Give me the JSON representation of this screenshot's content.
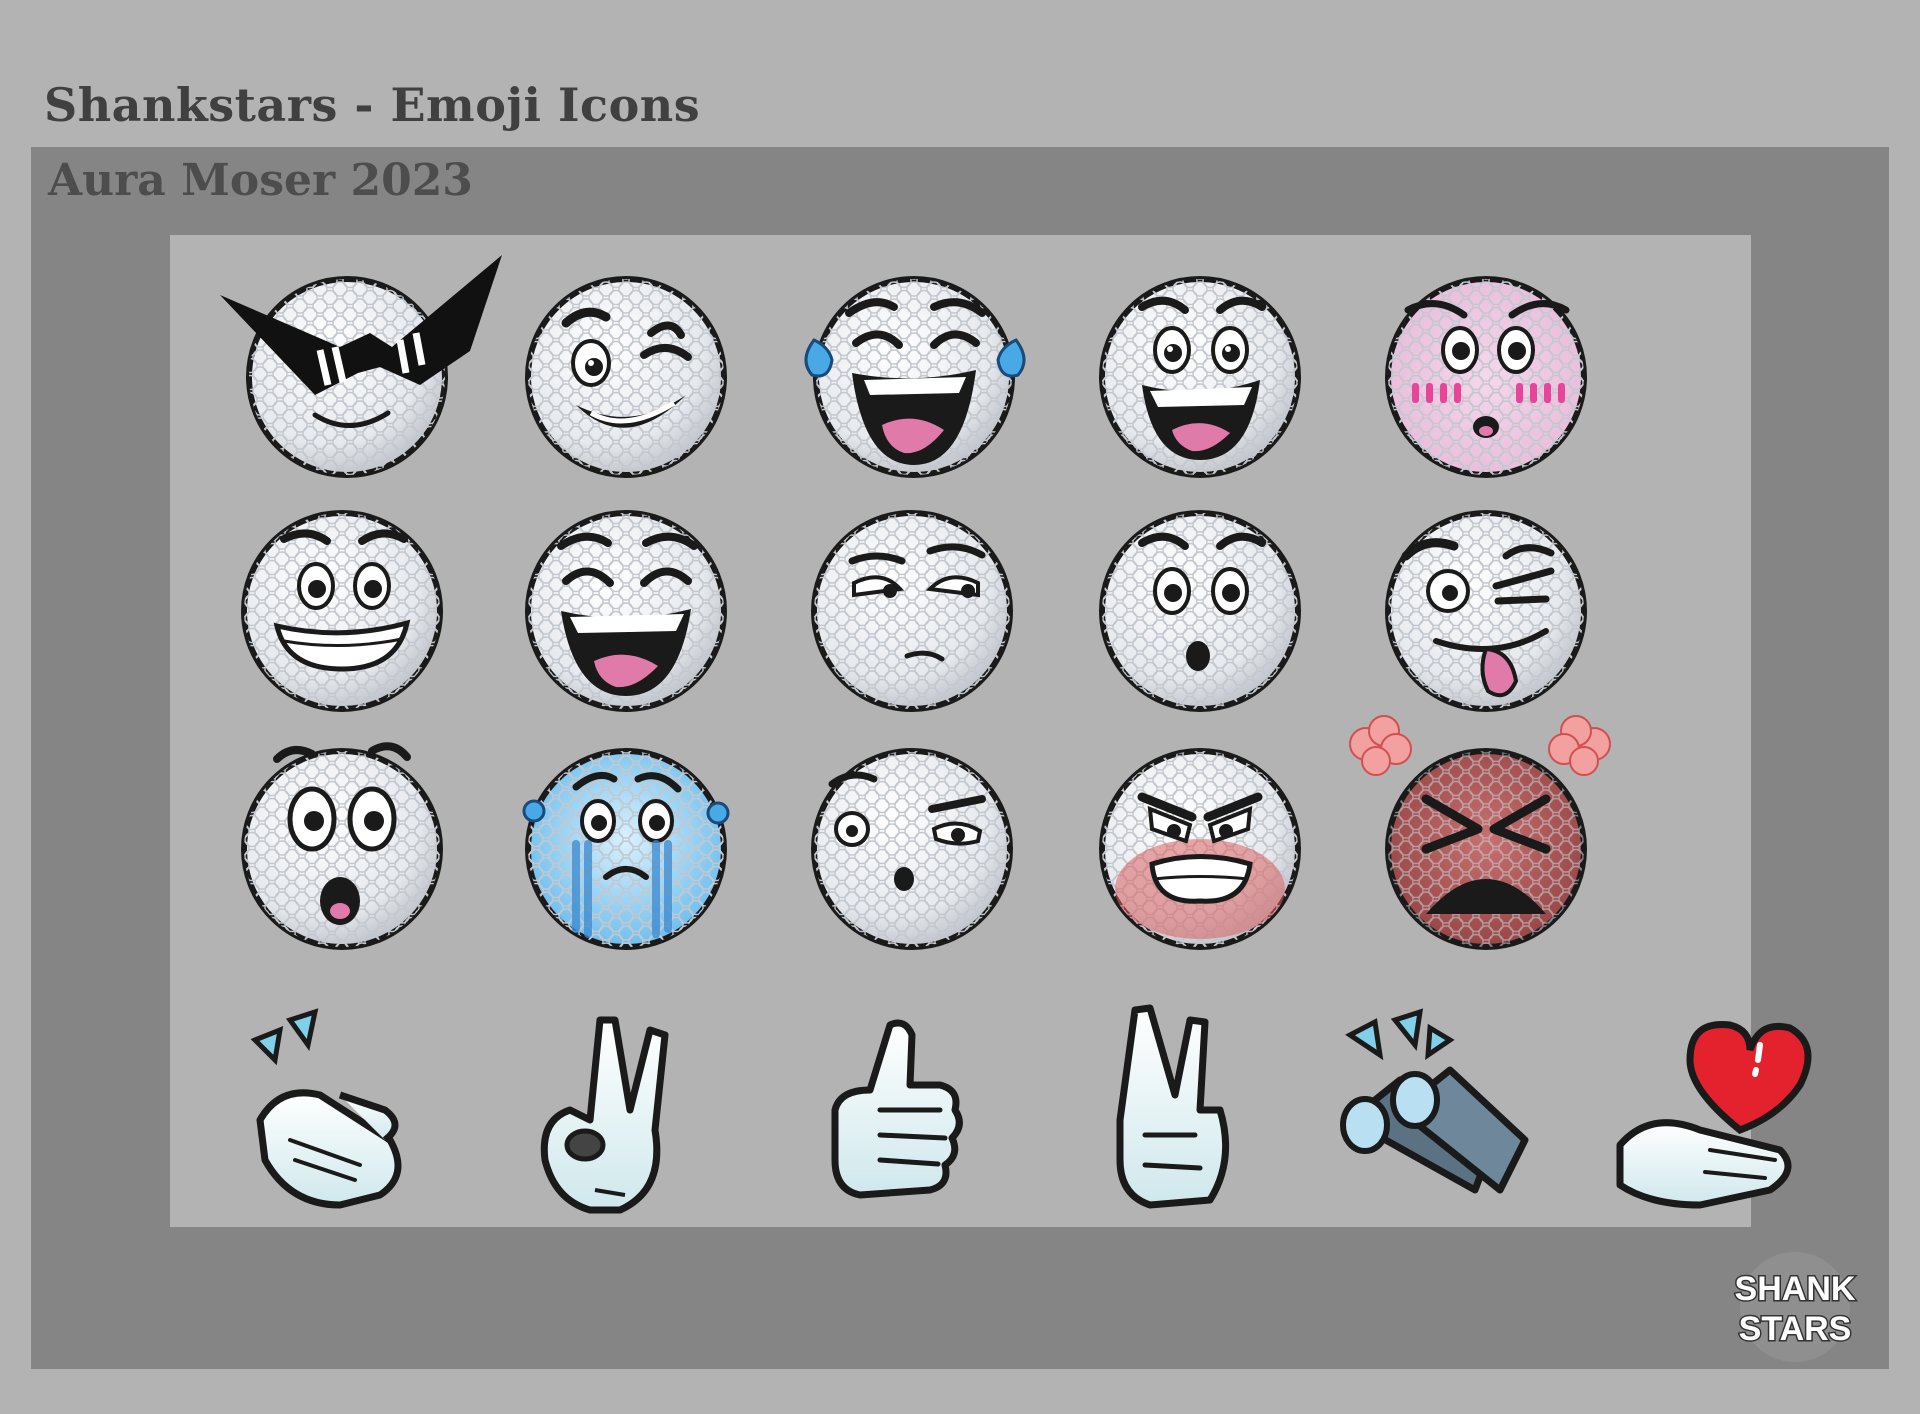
{
  "header": {
    "title": "Shankstars - Emoji Icons",
    "subtitle": "Aura Moser 2023"
  },
  "logo": {
    "text_line1": "SHANK",
    "text_line2": "STARS"
  },
  "colors": {
    "background": "#b3b3b3",
    "frame": "#858585",
    "ball_white": "#eef0f3",
    "ball_outline": "#1a1a1a",
    "tongue_pink": "#e07aa8",
    "blush_pink": "#e8449a",
    "tear_blue": "#48a9e6",
    "angry_red": "#c85b5b",
    "heart_red": "#e3222e"
  },
  "emojis": [
    {
      "icon": "cool-sunglasses-icon",
      "row": 1
    },
    {
      "icon": "wink-smirk-icon",
      "row": 1
    },
    {
      "icon": "tears-of-joy-icon",
      "row": 1
    },
    {
      "icon": "big-grin-icon",
      "row": 1
    },
    {
      "icon": "blushing-icon",
      "row": 1
    },
    {
      "icon": "wide-smile-icon",
      "row": 2
    },
    {
      "icon": "happy-laugh-icon",
      "row": 2
    },
    {
      "icon": "skeptical-icon",
      "row": 2
    },
    {
      "icon": "surprised-icon",
      "row": 2
    },
    {
      "icon": "crazy-tongue-icon",
      "row": 2
    },
    {
      "icon": "shocked-icon",
      "row": 3
    },
    {
      "icon": "crying-icon",
      "row": 3
    },
    {
      "icon": "suspicious-icon",
      "row": 3
    },
    {
      "icon": "angry-grimace-icon",
      "row": 3
    },
    {
      "icon": "furious-icon",
      "row": 3
    },
    {
      "icon": "clapping-hands-icon",
      "row": 4
    },
    {
      "icon": "ok-hand-icon",
      "row": 4
    },
    {
      "icon": "thumbs-up-icon",
      "row": 4
    },
    {
      "icon": "fingers-crossed-icon",
      "row": 4
    },
    {
      "icon": "binoculars-icon",
      "row": 4
    },
    {
      "icon": "heart-in-hand-icon",
      "row": 4
    }
  ]
}
